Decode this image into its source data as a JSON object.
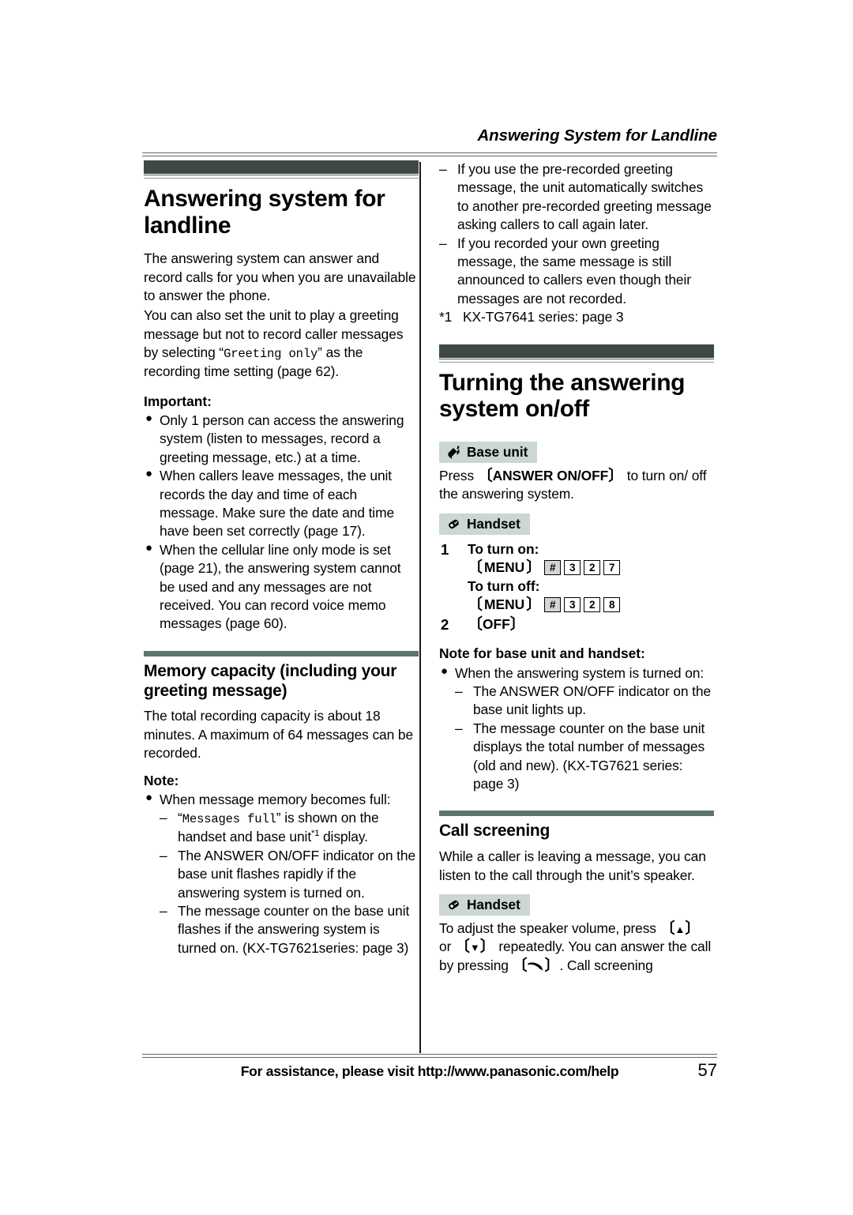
{
  "header": {
    "running_title": "Answering System for Landline"
  },
  "left_column": {
    "chapter_title": "Answering system for landline",
    "intro_paragraphs": [
      "The answering system can answer and record calls for you when you are unavailable to answer the phone.",
      "You can also set the unit to play a greeting message but not to record caller messages by selecting"
    ],
    "intro_mono_value": "Greeting only",
    "intro_tail": "as the recording time setting (page 62).",
    "important_label": "Important:",
    "important_bullets": [
      "Only 1 person can access the answering system (listen to messages, record a greeting message, etc.) at a time.",
      "When callers leave messages, the unit records the day and time of each message. Make sure the date and time have been set correctly (page 17).",
      "When the cellular line only mode is set (page 21), the answering system cannot be used and any messages are not received. You can record voice memo messages (page 60)."
    ],
    "memory_section": {
      "title": "Memory capacity (including your greeting message)",
      "body": "The total recording capacity is about 18 minutes. A maximum of 64 messages can be recorded.",
      "note_label": "Note:",
      "note_bullet": "When message memory becomes full:",
      "note_dashes": [
        {
          "mono": "Messages full",
          "prefix": "“",
          "suffix": "” is shown on the handset and base unit",
          "footnote_mark": "*1",
          "tail": " display."
        },
        {
          "text": "The ANSWER ON/OFF indicator on the base unit flashes rapidly if the answering system is turned on."
        },
        {
          "text": "The message counter on the base unit flashes if the answering system is turned on. (KX-TG7621series: page 3)"
        }
      ]
    }
  },
  "right_column": {
    "top_dashes": [
      "If you use the pre-recorded greeting message, the unit automatically switches to another pre-recorded greeting message asking callers to call again later.",
      "If you recorded your own greeting message, the same message is still announced to callers even though their messages are not recorded."
    ],
    "footnote": {
      "mark": "*1",
      "text": "KX-TG7641 series: page 3"
    },
    "turning_section": {
      "title": "Turning the answering system on/off",
      "base_unit_badge": "Base unit",
      "base_unit_icon": "press-button-icon",
      "base_unit_text_before": "Press",
      "base_unit_key": "ANSWER ON/OFF",
      "base_unit_text_after": "to turn on/ off the answering system.",
      "handset_badge": "Handset",
      "handset_icon": "cordless-handset-icon",
      "steps": [
        {
          "number": "1",
          "lines": [
            {
              "type": "text",
              "value": "To turn on:"
            },
            {
              "type": "keys",
              "menu": "MENU",
              "keys": [
                "#",
                "3",
                "2",
                "7"
              ]
            },
            {
              "type": "text",
              "value": "To turn off:"
            },
            {
              "type": "keys",
              "menu": "MENU",
              "keys": [
                "#",
                "3",
                "2",
                "8"
              ]
            }
          ]
        },
        {
          "number": "2",
          "lines": [
            {
              "type": "bracket",
              "value": "OFF"
            }
          ]
        }
      ],
      "note_label": "Note for base unit and handset:",
      "note_bullet": "When the answering system is turned on:",
      "note_dashes": [
        "The ANSWER ON/OFF indicator on the base unit lights up.",
        "The message counter on the base unit displays the total number of messages (old and new). (KX-TG7621 series: page 3)"
      ]
    },
    "call_screening_section": {
      "title": "Call screening",
      "body": "While a caller is leaving a message, you can listen to the call through the unit’s speaker.",
      "handset_badge": "Handset",
      "handset_icon": "cordless-handset-icon",
      "instruction_1": "To adjust the speaker volume, press",
      "key_up": "▲",
      "instruction_2": "or",
      "key_down": "▼",
      "instruction_3": "repeatedly. You can answer the call by pressing",
      "key_talk": "talk-handset-icon",
      "instruction_4": ". Call screening"
    }
  },
  "footer": {
    "text": "For assistance, please visit http://www.panasonic.com/help",
    "page_number": "57"
  },
  "colors": {
    "chapter_bar": "#3e4847",
    "section_rule": "#5f7370",
    "badge_bg": "#ccd6d4",
    "rule": "#5c6a69"
  }
}
